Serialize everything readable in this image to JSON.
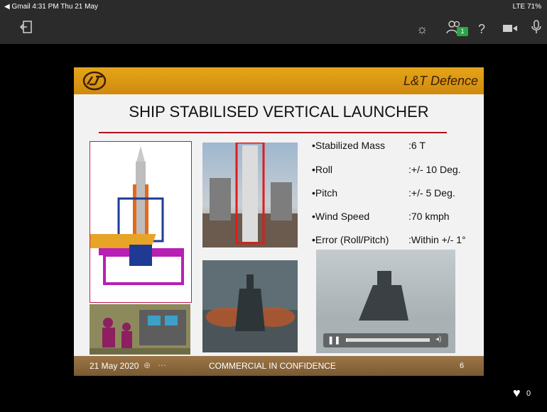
{
  "status_bar": {
    "left": "◀ Gmail  4:31 PM  Thu 21 May",
    "right": "LTE 71%"
  },
  "toolbar": {
    "participants_badge": "1"
  },
  "slide": {
    "brand": "L&T Defence",
    "title": "SHIP STABILISED VERTICAL LAUNCHER",
    "specs": [
      {
        "label": "•Stabilized Mass",
        "value": ":6 T"
      },
      {
        "label": "•Roll",
        "value": ":+/- 10 Deg."
      },
      {
        "label": "•Pitch",
        "value": ":+/- 5 Deg."
      },
      {
        "label": "•Wind Speed",
        "value": ":70 kmph"
      },
      {
        "label": "•Error (Roll/Pitch)",
        "value": ":Within +/- 1°"
      }
    ],
    "footer": {
      "date": "21 May 2020",
      "confidential": "COMMERCIAL IN CONFIDENCE",
      "page": "6"
    }
  },
  "video": {
    "progress": 0.02
  },
  "reactions": {
    "heart_count": "0"
  },
  "colors": {
    "header": "#e5a51a",
    "rule": "#b0131a",
    "badge": "#28a745"
  }
}
